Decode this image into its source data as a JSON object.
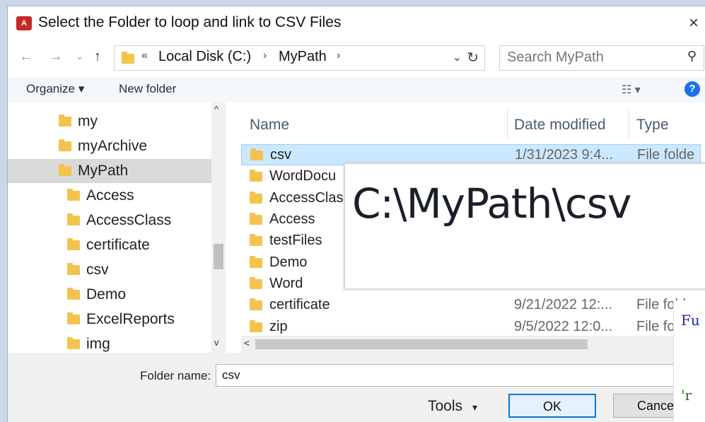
{
  "window": {
    "title": "Select the Folder to loop and link to CSV Files",
    "close": "×",
    "app_icon_text": "A"
  },
  "nav": {
    "back": "←",
    "forward": "→",
    "recent": "⌄",
    "up": "↑",
    "crumb_prefix": "«",
    "crumbs": [
      "Local Disk (C:)",
      "MyPath"
    ],
    "crumb_sep": "›",
    "dropdown": "⌄",
    "refresh": "↻",
    "search_placeholder": "Search MyPath",
    "search_icon": "⚲"
  },
  "toolbar": {
    "organize": "Organize ▾",
    "new_folder": "New folder",
    "view_icon": "☷ ▾",
    "help": "?"
  },
  "tree": {
    "items": [
      {
        "label": "my"
      },
      {
        "label": "myArchive"
      },
      {
        "label": "MyPath"
      },
      {
        "label": "Access"
      },
      {
        "label": "AccessClass"
      },
      {
        "label": "certificate"
      },
      {
        "label": "csv"
      },
      {
        "label": "Demo"
      },
      {
        "label": "ExcelReports"
      },
      {
        "label": "img"
      }
    ],
    "up_arrow": "^",
    "down_arrow": "v"
  },
  "files": {
    "columns": {
      "name": "Name",
      "date": "Date modified",
      "type": "Type"
    },
    "rows": [
      {
        "name": "csv",
        "date": "1/31/2023 9:4...",
        "type": "File folde"
      },
      {
        "name": "WordDocu",
        "date": "",
        "type": ""
      },
      {
        "name": "AccessClas",
        "date": "",
        "type": ""
      },
      {
        "name": "Access",
        "date": "",
        "type": ""
      },
      {
        "name": "testFiles",
        "date": "",
        "type": ""
      },
      {
        "name": "Demo",
        "date": "",
        "type": ""
      },
      {
        "name": "Word",
        "date": "",
        "type": ""
      },
      {
        "name": "certificate",
        "date": "9/21/2022 12:...",
        "type": "File folde"
      },
      {
        "name": "zip",
        "date": "9/5/2022 12:0...",
        "type": "File fo"
      }
    ],
    "scroll_left": "<"
  },
  "bottom": {
    "folder_name_label": "Folder name:",
    "folder_name_value": "csv",
    "tools": "Tools",
    "tools_arrow": "▾",
    "ok": "OK",
    "cancel": "Cancel"
  },
  "overlay": {
    "path_text": "C:\\MyPath\\csv"
  },
  "code": {
    "line1": "Fu",
    "line2": "'r"
  }
}
